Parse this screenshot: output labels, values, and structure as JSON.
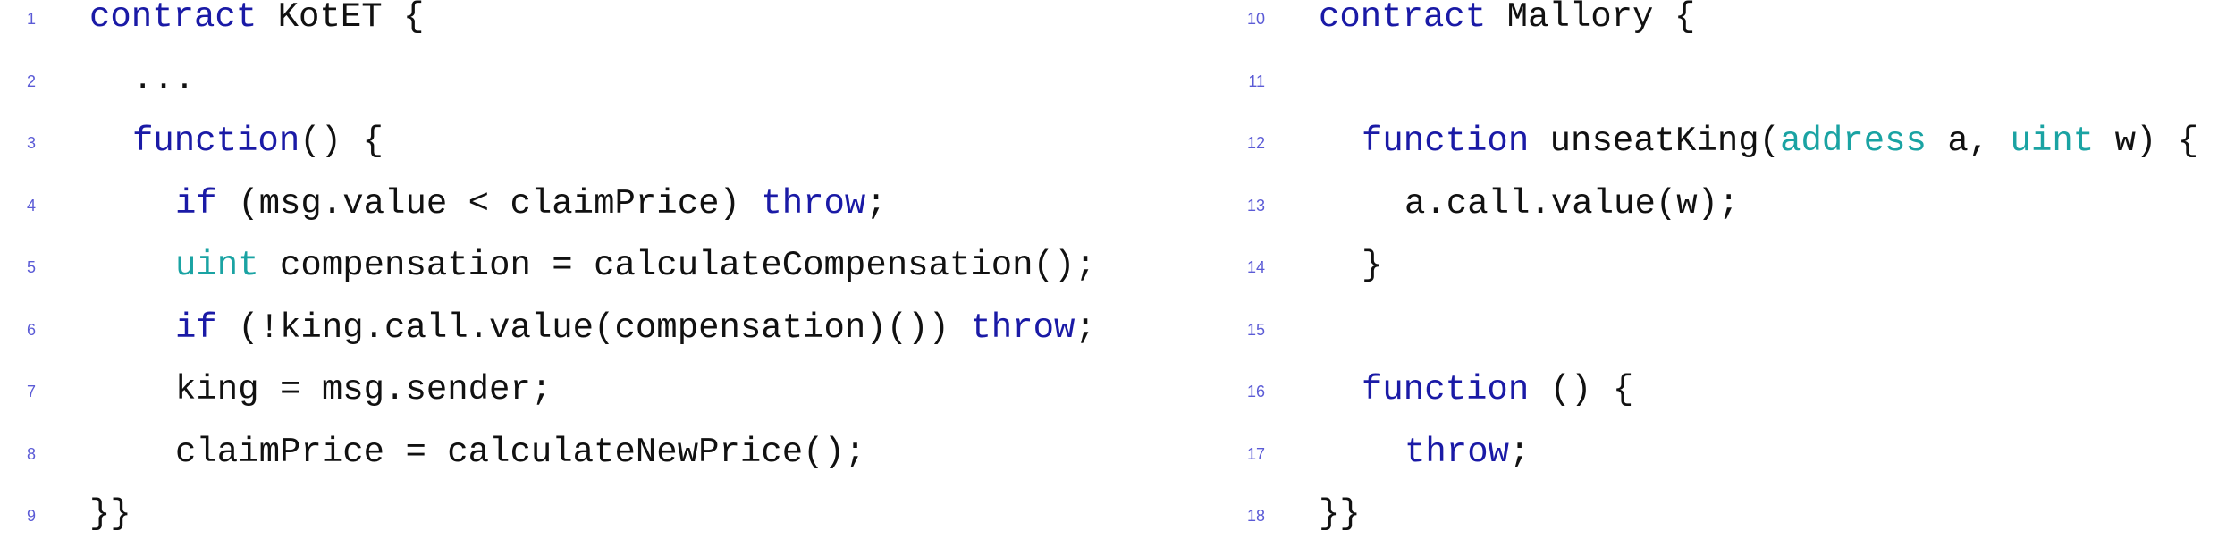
{
  "left_listing": {
    "lines": [
      {
        "num": "1",
        "indent": 0,
        "tokens": [
          {
            "t": "contract",
            "c": "kw"
          },
          {
            "t": " KotET {",
            "c": ""
          }
        ]
      },
      {
        "num": "2",
        "indent": 1,
        "tokens": [
          {
            "t": "...",
            "c": ""
          }
        ]
      },
      {
        "num": "3",
        "indent": 1,
        "tokens": [
          {
            "t": "function",
            "c": "kw"
          },
          {
            "t": "() {",
            "c": ""
          }
        ]
      },
      {
        "num": "4",
        "indent": 2,
        "tokens": [
          {
            "t": "if",
            "c": "kw"
          },
          {
            "t": " (msg.value < claimPrice) ",
            "c": ""
          },
          {
            "t": "throw",
            "c": "kw"
          },
          {
            "t": ";",
            "c": ""
          }
        ]
      },
      {
        "num": "5",
        "indent": 2,
        "tokens": [
          {
            "t": "uint",
            "c": "ty"
          },
          {
            "t": " compensation = calculateCompensation();",
            "c": ""
          }
        ]
      },
      {
        "num": "6",
        "indent": 2,
        "tokens": [
          {
            "t": "if",
            "c": "kw"
          },
          {
            "t": " (!king.call.value(compensation)()) ",
            "c": ""
          },
          {
            "t": "throw",
            "c": "kw"
          },
          {
            "t": ";",
            "c": ""
          }
        ]
      },
      {
        "num": "7",
        "indent": 2,
        "tokens": [
          {
            "t": "king = msg.sender;",
            "c": ""
          }
        ]
      },
      {
        "num": "8",
        "indent": 2,
        "tokens": [
          {
            "t": "claimPrice = calculateNewPrice();",
            "c": ""
          }
        ]
      },
      {
        "num": "9",
        "indent": 0,
        "tokens": [
          {
            "t": "}}",
            "c": ""
          }
        ]
      }
    ]
  },
  "right_listing": {
    "lines": [
      {
        "num": "10",
        "indent": 0,
        "tokens": [
          {
            "t": "contract",
            "c": "kw"
          },
          {
            "t": " Mallory {",
            "c": ""
          }
        ]
      },
      {
        "num": "11",
        "indent": 0,
        "tokens": []
      },
      {
        "num": "12",
        "indent": 1,
        "tokens": [
          {
            "t": "function",
            "c": "kw"
          },
          {
            "t": " unseatKing(",
            "c": ""
          },
          {
            "t": "address",
            "c": "ty"
          },
          {
            "t": " a, ",
            "c": ""
          },
          {
            "t": "uint",
            "c": "ty"
          },
          {
            "t": " w) {",
            "c": ""
          }
        ]
      },
      {
        "num": "13",
        "indent": 2,
        "tokens": [
          {
            "t": "a.call.value(w);",
            "c": ""
          }
        ]
      },
      {
        "num": "14",
        "indent": 1,
        "tokens": [
          {
            "t": "}",
            "c": ""
          }
        ]
      },
      {
        "num": "15",
        "indent": 0,
        "tokens": []
      },
      {
        "num": "16",
        "indent": 1,
        "tokens": [
          {
            "t": "function",
            "c": "kw"
          },
          {
            "t": " () {",
            "c": ""
          }
        ]
      },
      {
        "num": "17",
        "indent": 2,
        "tokens": [
          {
            "t": "throw",
            "c": "kw"
          },
          {
            "t": ";",
            "c": ""
          }
        ]
      },
      {
        "num": "18",
        "indent": 0,
        "tokens": [
          {
            "t": "}}",
            "c": ""
          }
        ]
      }
    ]
  },
  "colors": {
    "keyword": "#1a1aa6",
    "type": "#1aa3a3",
    "text": "#111111",
    "line_number": "#5b5bd6"
  }
}
